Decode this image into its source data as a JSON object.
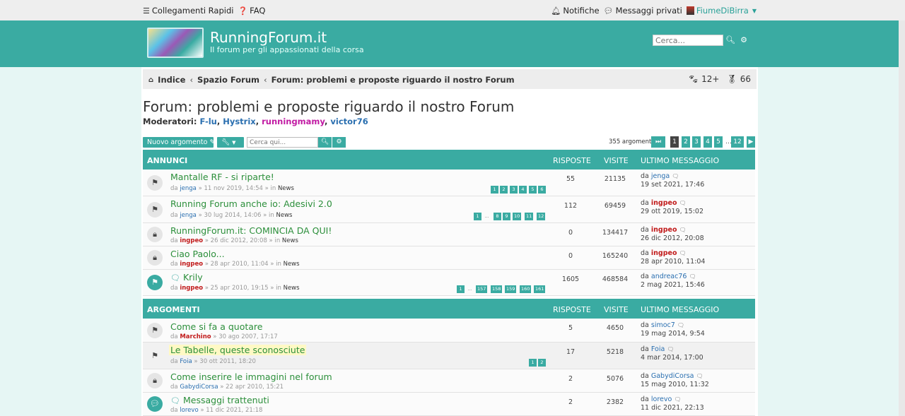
{
  "topbar": {
    "quick_links": "Collegamenti Rapidi",
    "faq": "FAQ",
    "notifications": "Notifiche",
    "messages": "Messaggi privati",
    "username": "FiumeDiBirra"
  },
  "header": {
    "site_title": "RunningForum.it",
    "site_desc": "Il forum per gli appassionati della corsa",
    "search_placeholder": "Cerca..."
  },
  "breadcrumb": {
    "home": "Indice",
    "section": "Spazio Forum",
    "current": "Forum: problemi e proposte riguardo il nostro Forum"
  },
  "stats": {
    "online": "12+",
    "medals": "66"
  },
  "forum": {
    "title": "Forum: problemi e proposte riguardo il nostro Forum",
    "moderators_label": "Moderatori:",
    "moderators": [
      "F-lu",
      "Hystrix",
      "runningmamy",
      "victor76"
    ]
  },
  "actions": {
    "new_topic": "Nuovo argomento",
    "search_placeholder": "Cerca qui...",
    "topics_count": "355 argomenti",
    "pages": [
      "1",
      "2",
      "3",
      "4",
      "5",
      "…",
      "12"
    ],
    "current_page": "1"
  },
  "columns": {
    "replies": "RISPOSTE",
    "views": "VISITE",
    "last": "ULTIMO MESSAGGIO"
  },
  "announcements": {
    "header": "ANNUNCI",
    "rows": [
      {
        "title": "Mantalle RF - si riparte!",
        "by": "da",
        "author": "jenga",
        "date": "11 nov 2019, 14:54",
        "in": "in",
        "forum": "News",
        "replies": "55",
        "views": "21135",
        "last_by": "jenga",
        "last_date": "19 set 2021, 17:46",
        "pages": [
          "1",
          "2",
          "3",
          "4",
          "5",
          "6"
        ]
      },
      {
        "title": "Running Forum anche io: Adesivi 2.0",
        "by": "da",
        "author": "jenga",
        "date": "30 lug 2014, 14:06",
        "in": "in",
        "forum": "News",
        "replies": "112",
        "views": "69459",
        "last_by": "ingpeo",
        "last_date": "29 ott 2019, 15:02",
        "pages": [
          "1",
          "…",
          "8",
          "9",
          "10",
          "11",
          "12"
        ]
      },
      {
        "title": "RunningForum.it: COMINCIA DA QUI!",
        "by": "da",
        "author": "ingpeo",
        "date": "26 dic 2012, 20:08",
        "in": "in",
        "forum": "News",
        "replies": "0",
        "views": "134417",
        "last_by": "ingpeo",
        "last_date": "26 dic 2012, 20:08",
        "pages": []
      },
      {
        "title": "Ciao Paolo...",
        "by": "da",
        "author": "ingpeo",
        "date": "28 apr 2010, 11:04",
        "in": "in",
        "forum": "News",
        "replies": "0",
        "views": "165240",
        "last_by": "ingpeo",
        "last_date": "28 apr 2010, 11:04",
        "pages": []
      },
      {
        "title": "Krily",
        "by": "da",
        "author": "ingpeo",
        "date": "25 apr 2010, 19:15",
        "in": "in",
        "forum": "News",
        "replies": "1605",
        "views": "468584",
        "last_by": "andreac76",
        "last_date": "2 mag 2021, 15:46",
        "pages": [
          "1",
          "…",
          "157",
          "158",
          "159",
          "160",
          "161"
        ]
      }
    ]
  },
  "topics": {
    "header": "ARGOMENTI",
    "rows": [
      {
        "title": "Come si fa a quotare",
        "by": "da",
        "author": "Marchino",
        "date": "30 ago 2007, 17:17",
        "replies": "5",
        "views": "4650",
        "last_by": "simoc7",
        "last_date": "19 mag 2014, 9:54",
        "pages": []
      },
      {
        "title": "Le Tabelle, queste sconosciute",
        "by": "da",
        "author": "Foia",
        "date": "30 ott 2011, 18:20",
        "replies": "17",
        "views": "5218",
        "last_by": "Foia",
        "last_date": "4 mar 2014, 17:00",
        "pages": [
          "1",
          "2"
        ]
      },
      {
        "title": "Come inserire le immagini nel forum",
        "by": "da",
        "author": "GabydiCorsa",
        "date": "22 apr 2010, 15:21",
        "replies": "2",
        "views": "5076",
        "last_by": "GabydiCorsa",
        "last_date": "15 mag 2010, 11:32",
        "pages": []
      },
      {
        "title": "Messaggi trattenuti",
        "by": "da",
        "author": "lorevo",
        "date": "11 dic 2021, 21:18",
        "replies": "2",
        "views": "2382",
        "last_by": "lorevo",
        "last_date": "11 dic 2021, 22:13",
        "pages": []
      }
    ]
  }
}
